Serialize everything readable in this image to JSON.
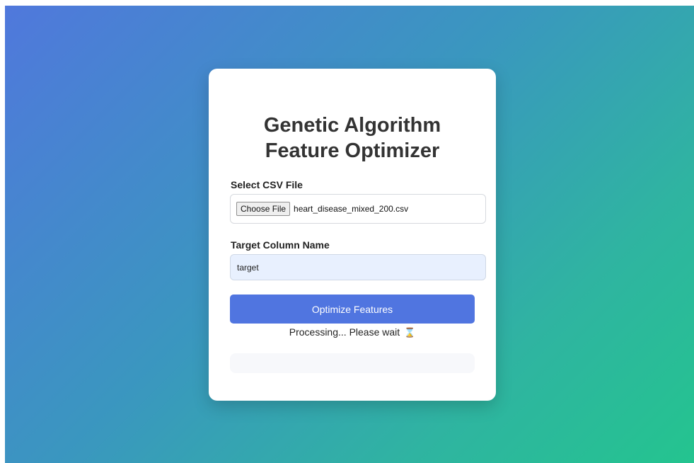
{
  "card": {
    "title": "Genetic Algorithm Feature Optimizer"
  },
  "form": {
    "file_label": "Select CSV File",
    "file_button_label": "Choose File",
    "file_name": "heart_disease_mixed_200.csv",
    "target_label": "Target Column Name",
    "target_value": "target",
    "submit_label": "Optimize Features"
  },
  "status": {
    "text": "Processing... Please wait",
    "icon": "hourglass-icon"
  },
  "colors": {
    "gradient_start": "#5078dc",
    "gradient_end": "#24c48f",
    "button_bg": "#5075e0",
    "input_bg": "#e8f0fe"
  }
}
